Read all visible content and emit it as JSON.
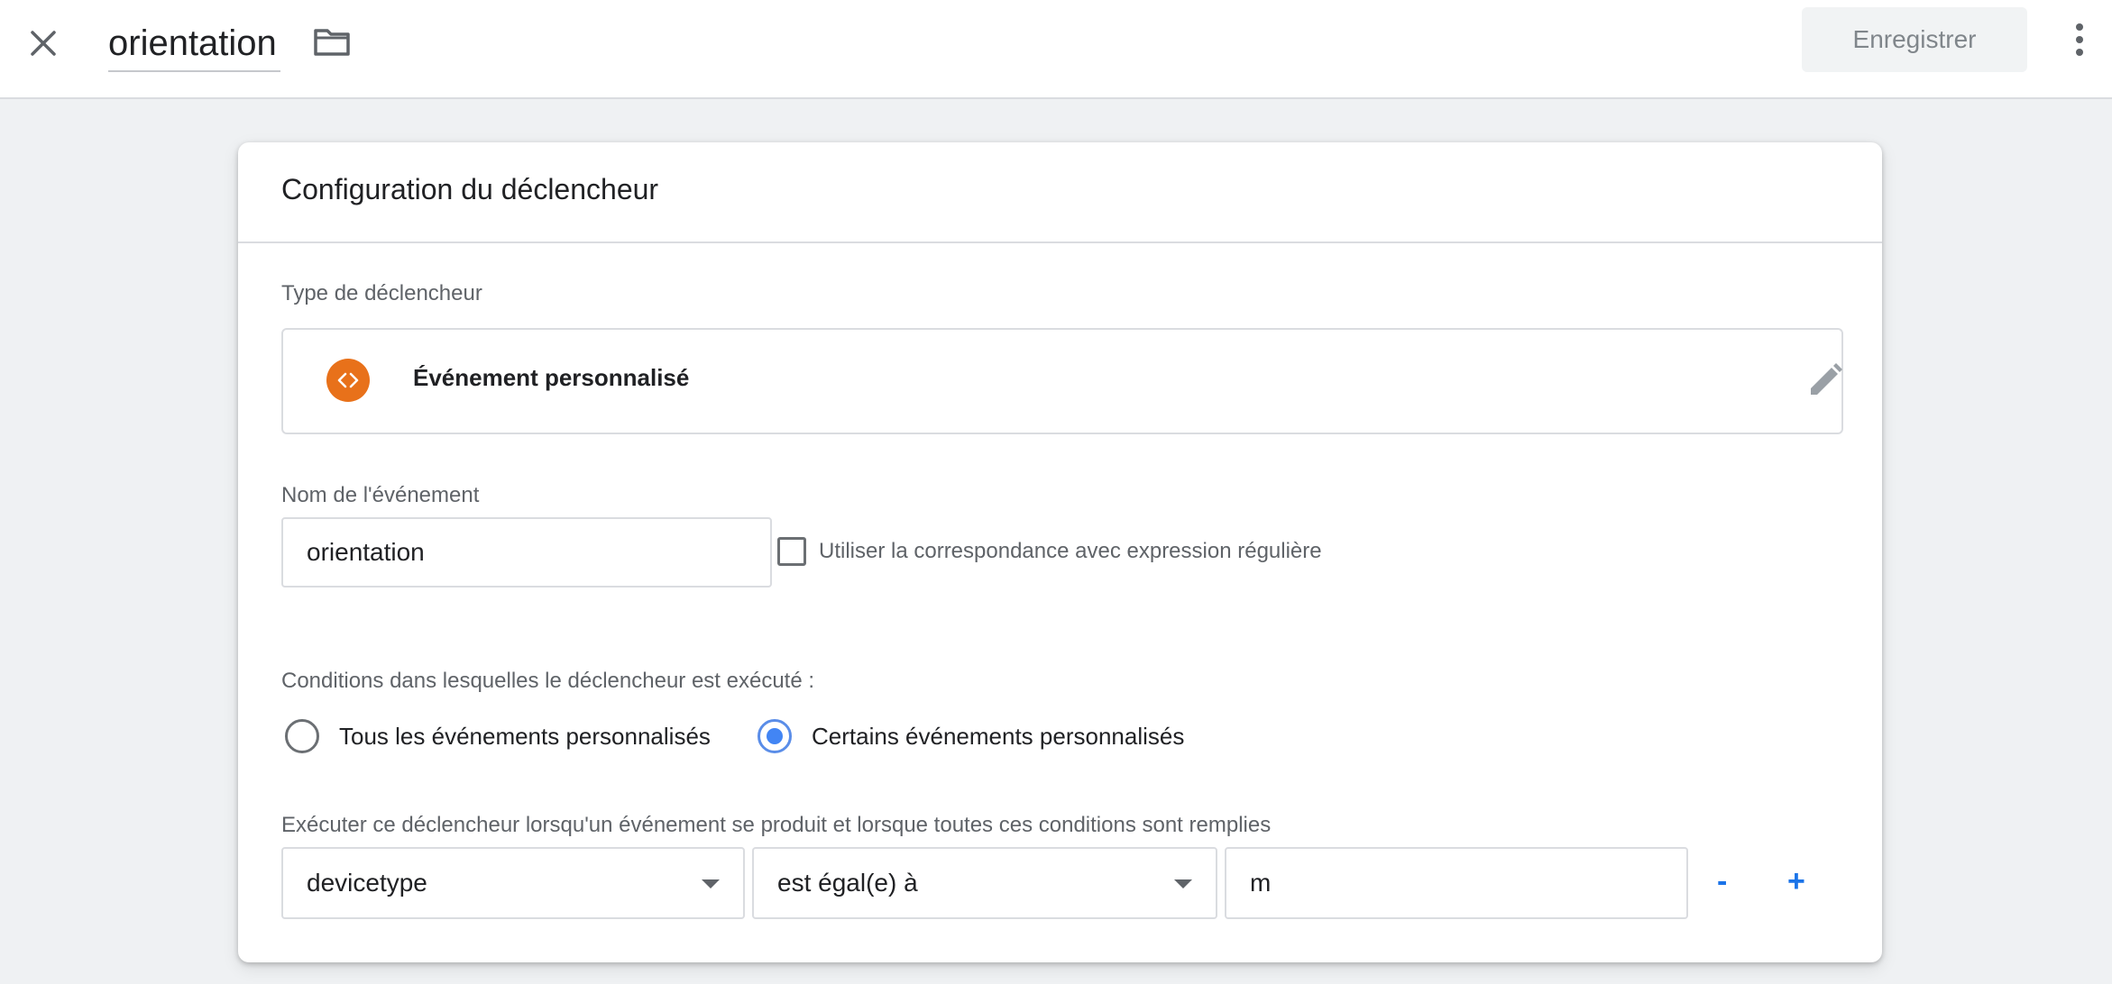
{
  "header": {
    "title": "orientation",
    "save_label": "Enregistrer"
  },
  "icons": {
    "close": "close-icon",
    "folder": "folder-icon",
    "more": "more-vert-icon",
    "trigger_type": "code-icon",
    "edit": "pencil-icon"
  },
  "colors": {
    "accent": "#1a73e8",
    "trigger_icon_bg": "#e8711a",
    "radio_selected": "#4285f4"
  },
  "card": {
    "title": "Configuration du déclencheur",
    "trigger_type_label": "Type de déclencheur",
    "trigger_type_name": "Événement personnalisé",
    "event_name_label": "Nom de l'événement",
    "event_name_value": "orientation",
    "regex_checkbox_label": "Utiliser la correspondance avec expression régulière",
    "regex_checked": false,
    "conditions_label": "Conditions dans lesquelles le déclencheur est exécuté :",
    "radio_all_label": "Tous les événements personnalisés",
    "radio_some_label": "Certains événements personnalisés",
    "selected_radio": "some",
    "rule_label": "Exécuter ce déclencheur lorsqu'un événement se produit et lorsque toutes ces conditions sont remplies",
    "rule": {
      "variable": "devicetype",
      "operator": "est égal(e) à",
      "value": "m"
    },
    "remove_label": "-",
    "add_label": "+"
  }
}
